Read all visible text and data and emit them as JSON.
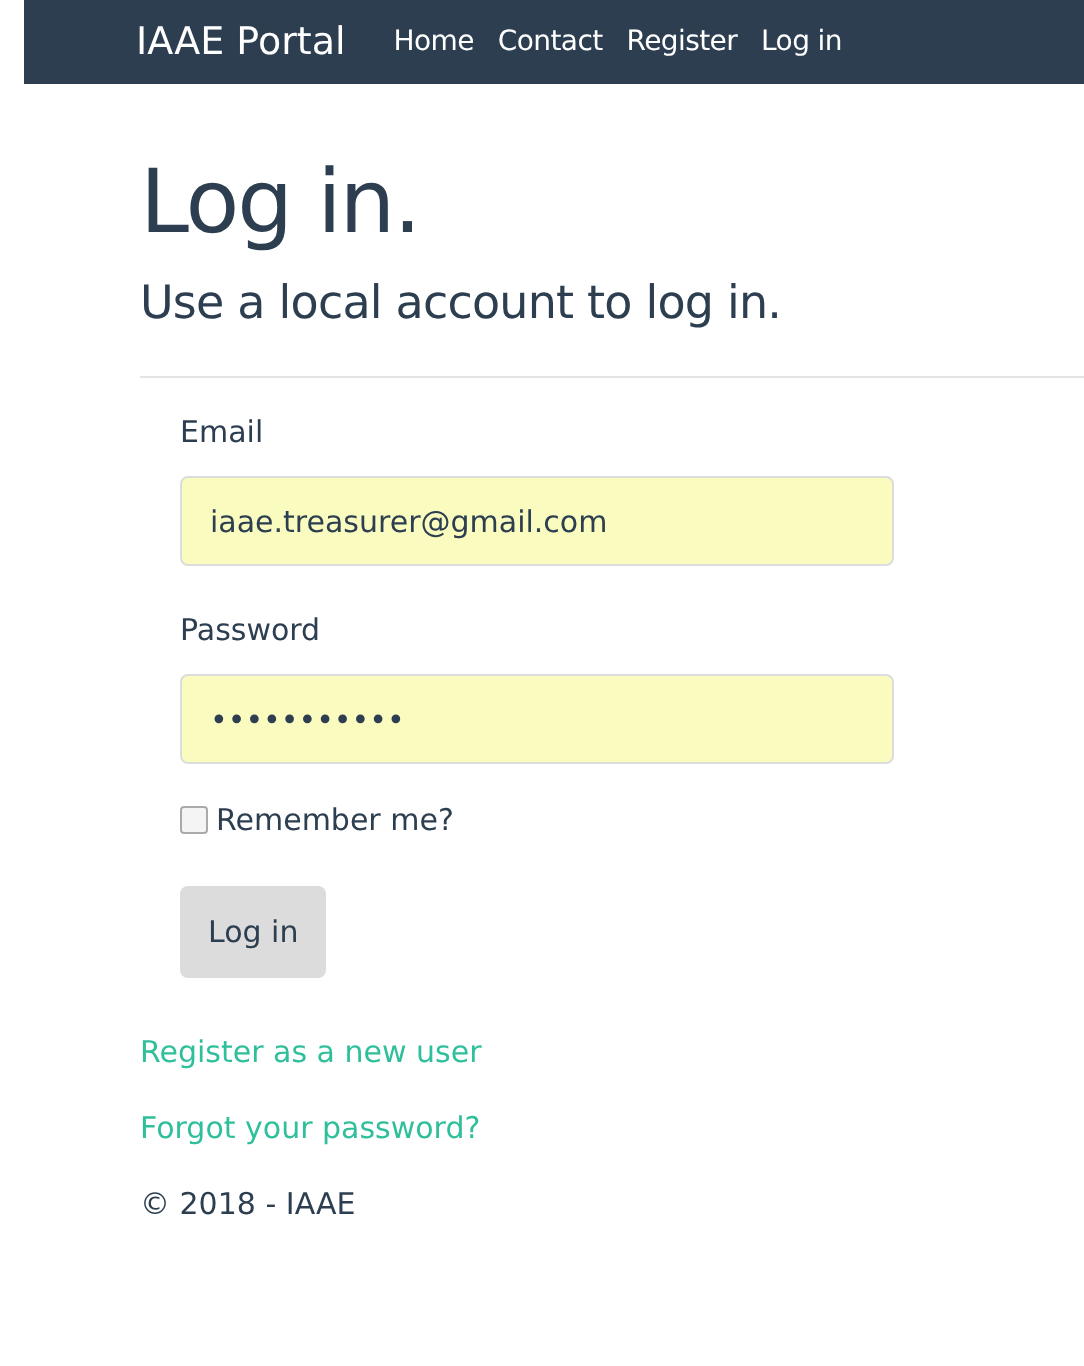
{
  "navbar": {
    "brand": "IAAE Portal",
    "links": [
      "Home",
      "Contact",
      "Register",
      "Log in"
    ]
  },
  "title": "Log in.",
  "subtitle": "Use a local account to log in.",
  "form": {
    "fields": [
      {
        "label": "Email",
        "value": "iaae.treasurer@gmail.com"
      },
      {
        "label": "Password",
        "value": "•••••••••••"
      }
    ],
    "remember": {
      "label": "Remember me?",
      "checked": false
    },
    "submit": "Log in"
  },
  "links": [
    "Register as a new user",
    "Forgot your password?"
  ],
  "footer": "© 2018 - IAAE"
}
